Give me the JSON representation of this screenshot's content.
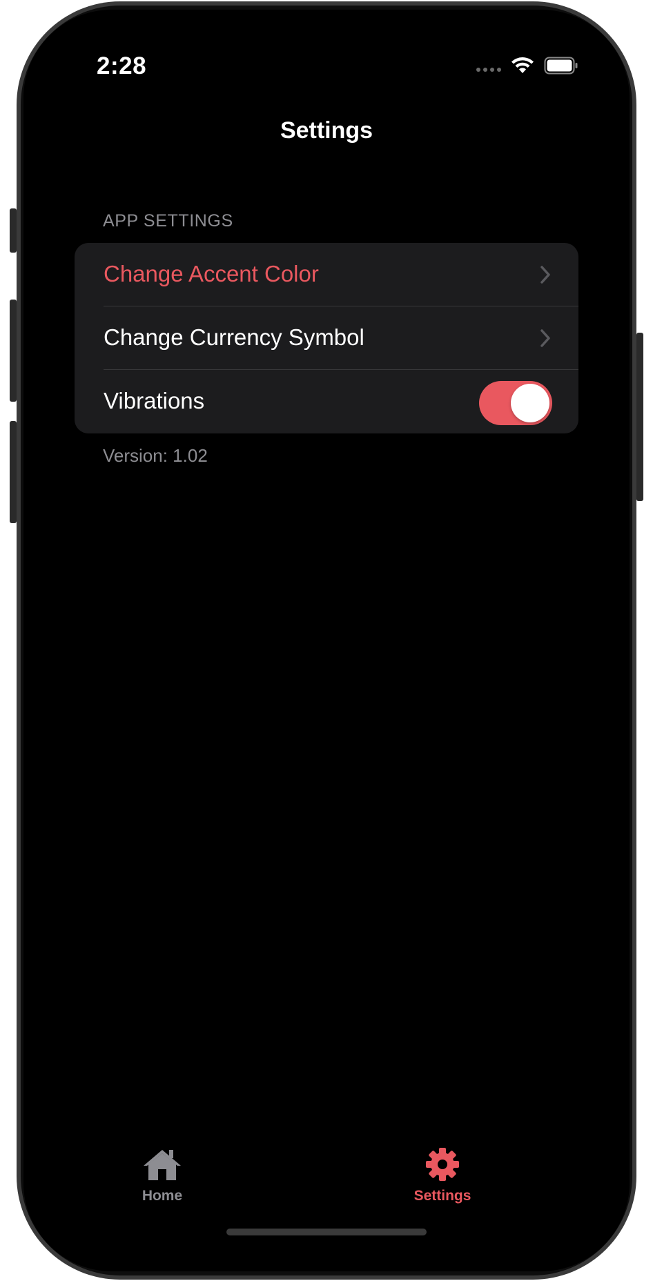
{
  "status_bar": {
    "time": "2:28"
  },
  "nav": {
    "title": "Settings"
  },
  "app_settings": {
    "header": "APP SETTINGS",
    "rows": [
      {
        "label": "Change Accent Color",
        "type": "disclosure"
      },
      {
        "label": "Change Currency Symbol",
        "type": "disclosure"
      },
      {
        "label": "Vibrations",
        "type": "toggle",
        "value": true
      }
    ],
    "footer": "Version: 1.02"
  },
  "tab_bar": {
    "items": [
      {
        "label": "Home",
        "icon": "house-icon",
        "selected": false
      },
      {
        "label": "Settings",
        "icon": "gear-icon",
        "selected": true
      }
    ]
  },
  "colors": {
    "accent": "#e9585f",
    "background": "#000000",
    "grouped_cell": "#1c1c1e",
    "secondary_text": "#8d8d92",
    "inactive_tab": "#8d8d92"
  }
}
